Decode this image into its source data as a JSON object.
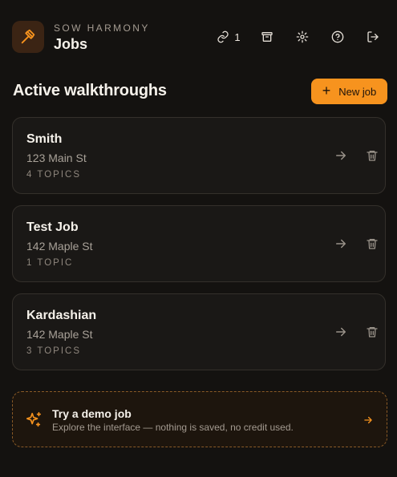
{
  "header": {
    "brand_name": "SOW HARMONY",
    "title": "Jobs",
    "icons": [
      "hammer-icon",
      "links-icon",
      "archive-icon",
      "gear-icon",
      "help-icon",
      "logout-icon"
    ],
    "links_count": "1"
  },
  "section": {
    "title": "Active walkthroughs",
    "new_job_label": "New job",
    "new_job_icon": "+"
  },
  "jobs": [
    {
      "name": "Smith",
      "address": "123 Main St",
      "topics": "4 TOPICS"
    },
    {
      "name": "Test Job",
      "address": "142 Maple St",
      "topics": "1 TOPIC"
    },
    {
      "name": "Kardashian",
      "address": "142 Maple St",
      "topics": "3 TOPICS"
    }
  ],
  "demo": {
    "title": "Try a demo job",
    "description": "Explore the interface — nothing is saved, no credit used."
  },
  "colors": {
    "background": "#141210",
    "accent": "#f7931e",
    "card_bg": "#1a1816",
    "card_border": "#34302b",
    "demo_border": "#8a5a26"
  }
}
